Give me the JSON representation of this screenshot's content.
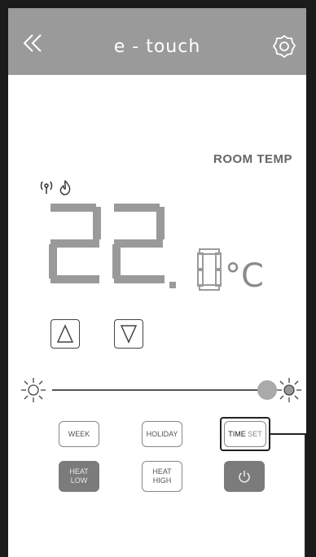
{
  "header": {
    "title": "e - touch",
    "back_icon": "double-chevron-left-icon",
    "settings_icon": "gear-icon",
    "background": "#9a9a9a"
  },
  "display": {
    "room_label": "ROOM TEMP",
    "temperature_whole": "22",
    "temperature_tenth": "0",
    "decimal_separator": ".",
    "unit": "°C",
    "status_icons": [
      "wifi-signal-icon",
      "flame-icon"
    ]
  },
  "controls": {
    "up_icon": "triangle-up-icon",
    "down_icon": "triangle-down-icon",
    "brightness": {
      "min_icon": "sun-outline-icon",
      "max_icon": "sun-filled-icon",
      "level": 1.0
    },
    "buttons": {
      "week": "WEEK",
      "holiday": "HOLIDAY",
      "time": "TIME",
      "set": "SET",
      "heat_low": [
        "HEAT",
        "LOW"
      ],
      "heat_high": [
        "HEAT",
        "HIGH"
      ],
      "power_icon": "power-icon"
    }
  }
}
